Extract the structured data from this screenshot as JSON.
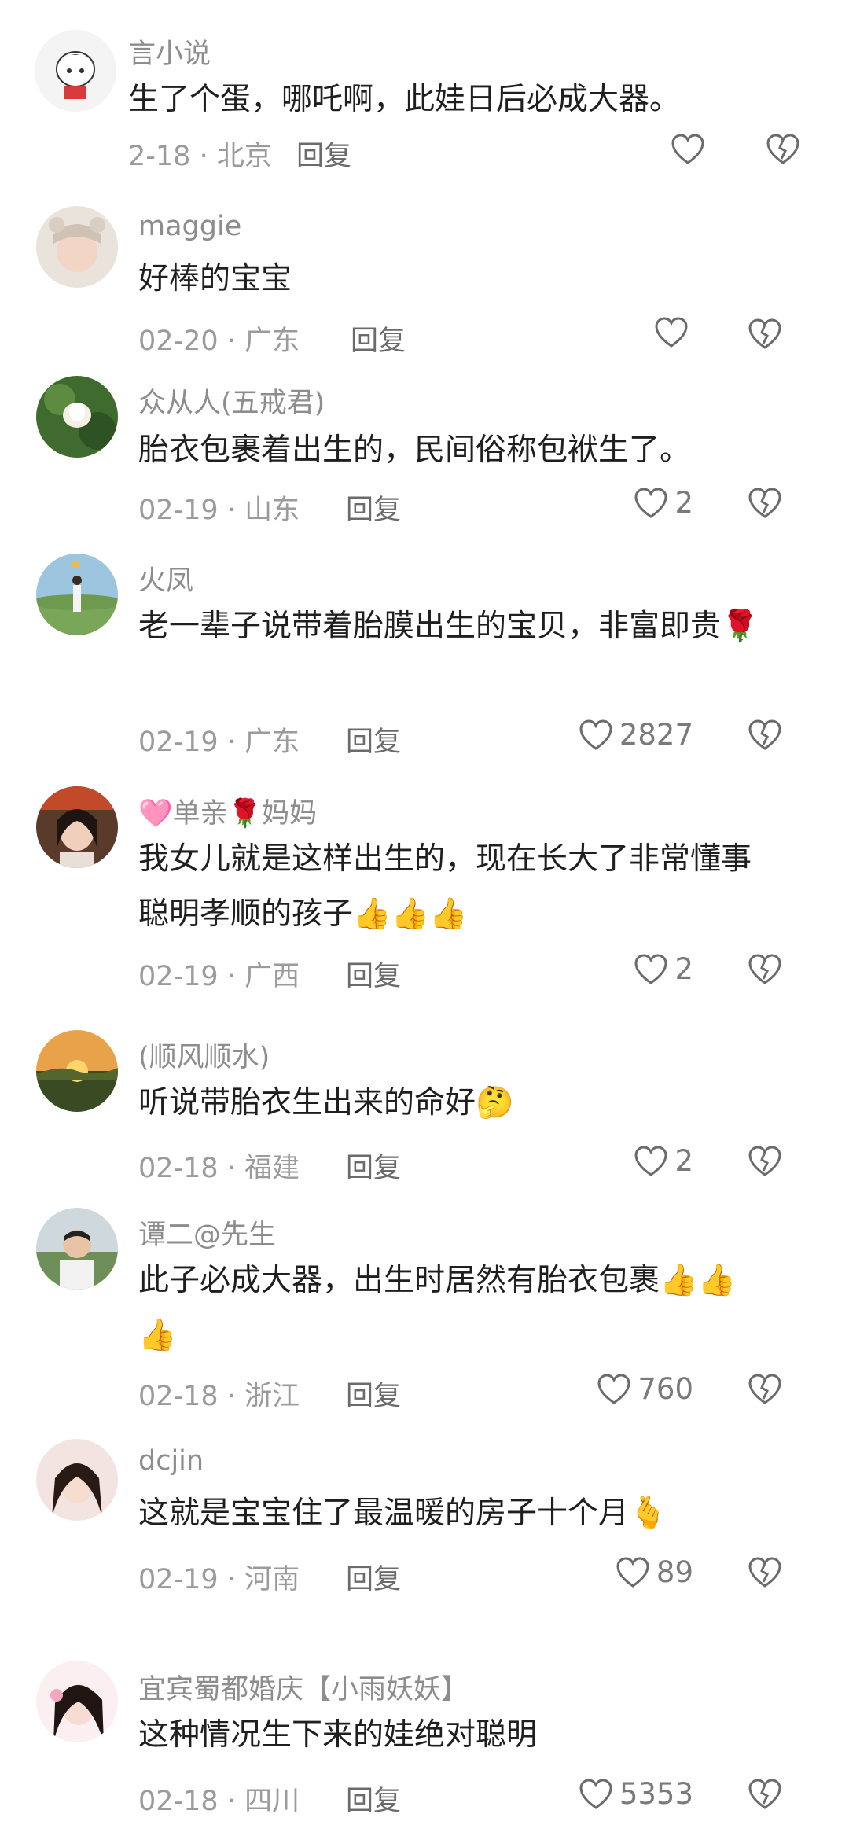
{
  "comments": [
    {
      "name": "言小说",
      "text": "生了个蛋，哪吒啊，此娃日后必成大器。",
      "date": "2-18",
      "location": "北京",
      "reply": "回复",
      "likes": ""
    },
    {
      "name": "maggie",
      "text": "好棒的宝宝",
      "date": "02-20",
      "location": "广东",
      "reply": "回复",
      "likes": ""
    },
    {
      "name": "众从人(五戒君)",
      "text": "胎衣包裹着出生的，民间俗称包袱生了。",
      "date": "02-19",
      "location": "山东",
      "reply": "回复",
      "likes": "2"
    },
    {
      "name": "火凤",
      "text": "老一辈子说带着胎膜出生的宝贝，非富即贵🌹",
      "date": "02-19",
      "location": "广东",
      "reply": "回复",
      "likes": "2827"
    },
    {
      "name": "🩷单亲🌹妈妈",
      "text": "我女儿就是这样出生的，现在长大了非常懂事聪明孝顺的孩子👍👍👍",
      "date": "02-19",
      "location": "广西",
      "reply": "回复",
      "likes": "2"
    },
    {
      "name": "(顺风顺水)",
      "text": "听说带胎衣生出来的命好🤔",
      "date": "02-18",
      "location": "福建",
      "reply": "回复",
      "likes": "2"
    },
    {
      "name": "谭二@先生",
      "text": "此子必成大器，出生时居然有胎衣包裹👍👍👍",
      "date": "02-18",
      "location": "浙江",
      "reply": "回复",
      "likes": "760"
    },
    {
      "name": "dcjin",
      "text": "这就是宝宝住了最温暖的房子十个月🫰",
      "date": "02-19",
      "location": "河南",
      "reply": "回复",
      "likes": "89"
    },
    {
      "name": "宜宾蜀都婚庆【小雨妖妖】",
      "text": "这种情况生下来的娃绝对聪明",
      "date": "02-18",
      "location": "四川",
      "reply": "回复",
      "likes": "5353"
    }
  ],
  "icons": {
    "like": "heart-outline-icon",
    "dislike": "broken-heart-icon",
    "avatar": "user-avatar"
  },
  "colors": {
    "name": "#8d8d8d",
    "meta": "#9b9b9b",
    "text": "#1f1f1f",
    "icon": "#6b6b6b"
  },
  "separator": " · "
}
